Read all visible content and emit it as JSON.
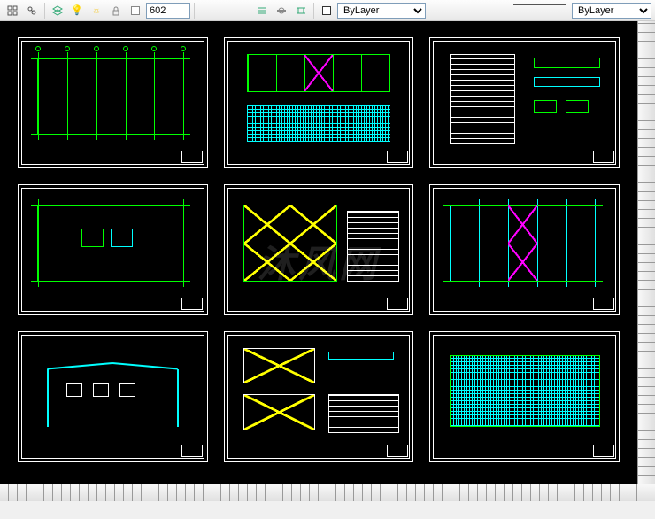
{
  "toolbar": {
    "layer_input": "602",
    "layer_dropdown": "ByLayer",
    "linetype_dropdown": "ByLayer"
  },
  "watermark": "沐风网",
  "canvas": {
    "sheet_count": 9,
    "colors": {
      "grid": "#00ff00",
      "structure": "#00ffff",
      "brace1": "#ff00ff",
      "brace2": "#ffff00",
      "frame": "#ffffff"
    }
  }
}
